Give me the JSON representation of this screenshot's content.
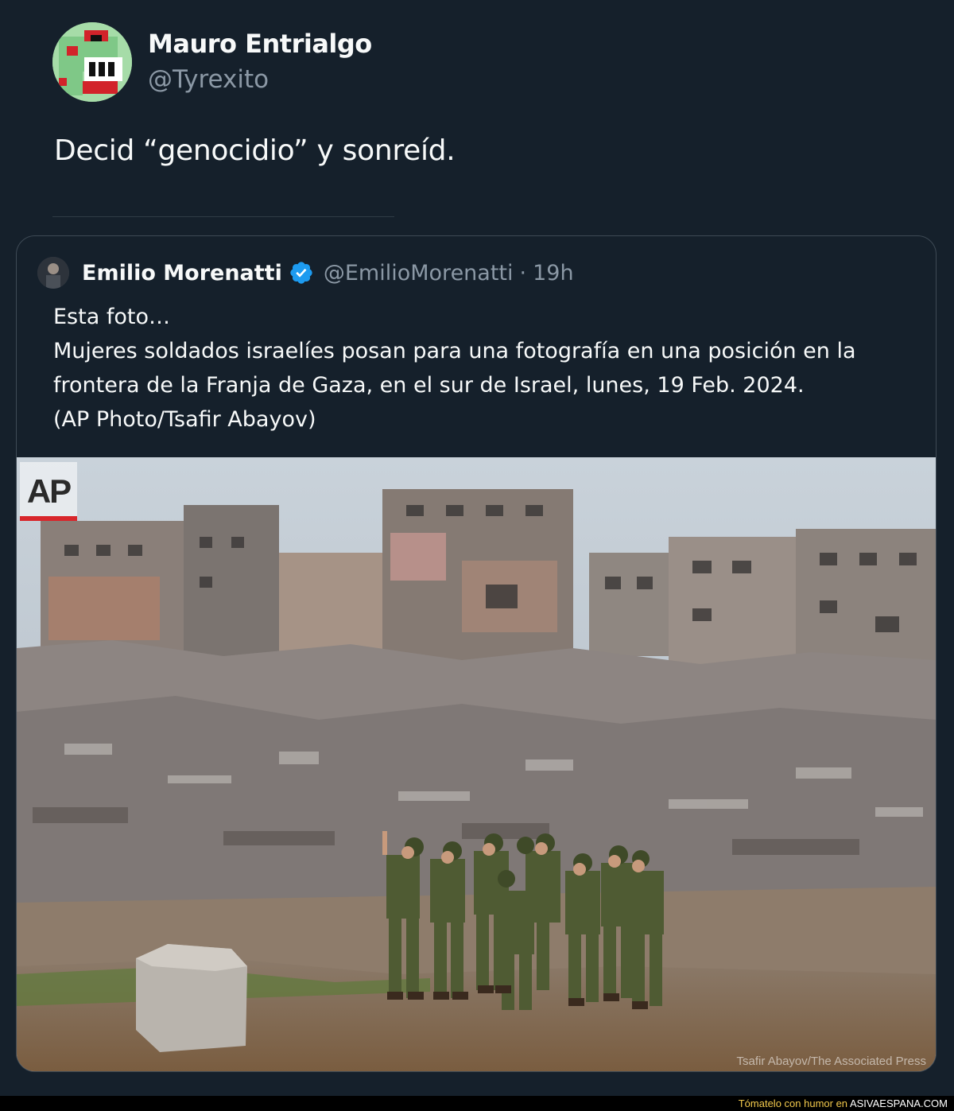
{
  "tweet": {
    "display_name": "Mauro Entrialgo",
    "handle": "@Tyrexito",
    "text": "Decid “genocidio” y sonreíd.",
    "avatar_icon": "dinosaur-avatar-icon"
  },
  "quoted_tweet": {
    "display_name": "Emilio Morenatti",
    "verified_icon": "verified-badge-icon",
    "handle": "@EmilioMorenatti",
    "separator": "·",
    "time": "19h",
    "text_lines": [
      "Esta foto…",
      "Mujeres soldados israelíes posan para una fotografía en una posición en la",
      "frontera de la Franja de Gaza, en el sur de Israel, lunes, 19 Feb. 2024.",
      "(AP Photo/Tsafir Abayov)"
    ],
    "photo": {
      "watermark_logo": "AP",
      "credit": "Tsafir Abayov/The Associated Press"
    }
  },
  "footer": {
    "prefix": "Tómatelo con humor en",
    "site": "ASIVAESPANA.COM"
  },
  "colors": {
    "background": "#15202b",
    "text": "#f7f9f9",
    "secondary_text": "#8b98a5",
    "verified_blue": "#1d9bf0"
  }
}
